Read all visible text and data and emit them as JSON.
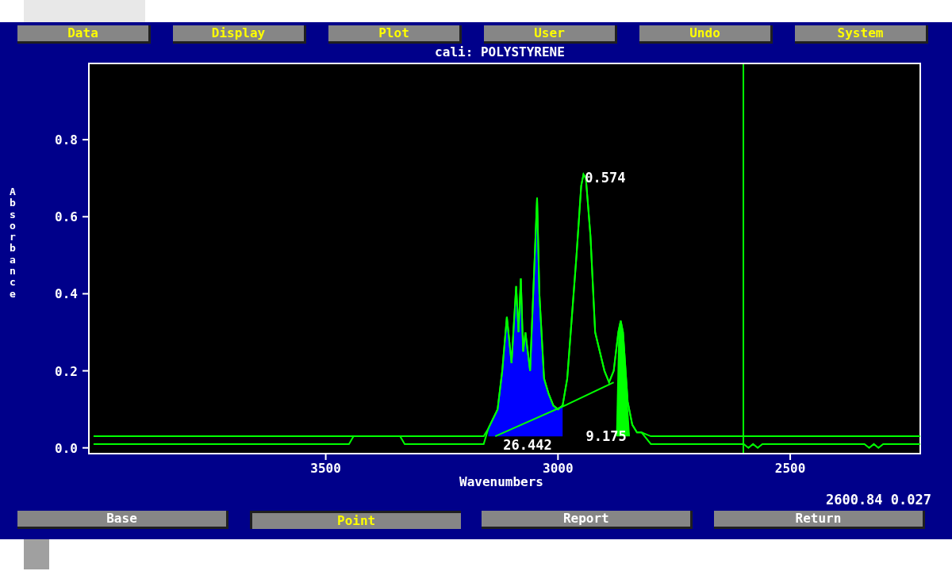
{
  "menu": [
    {
      "label": "Data"
    },
    {
      "label": "Display"
    },
    {
      "label": "Plot"
    },
    {
      "label": "User"
    },
    {
      "label": "Undo"
    },
    {
      "label": "System"
    }
  ],
  "chart": {
    "chart_data": {
      "type": "line",
      "title": "cali: POLYSTYRENE",
      "xlabel": "Wavenumbers",
      "ylabel": "Absorbance",
      "xlim": [
        4010,
        2220
      ],
      "ylim": [
        -0.015,
        1.0
      ],
      "xticks": [
        3500,
        3000,
        2500
      ],
      "yticks": [
        {
          "value": 0,
          "label": "0.0"
        },
        {
          "value": 0.2,
          "label": "0.2"
        },
        {
          "value": 0.4,
          "label": "0.4"
        },
        {
          "value": 0.6,
          "label": "0.6"
        },
        {
          "value": 0.8,
          "label": "0.8"
        }
      ],
      "x": [
        4000,
        3450,
        3440,
        3340,
        3330,
        3160,
        3150,
        3130,
        3120,
        3110,
        3100,
        3090,
        3085,
        3080,
        3075,
        3070,
        3060,
        3050,
        3045,
        3040,
        3030,
        3020,
        3010,
        3000,
        2990,
        2980,
        2960,
        2950,
        2945,
        2940,
        2930,
        2920,
        2900,
        2890,
        2880,
        2870,
        2865,
        2860,
        2850,
        2840,
        2830,
        2820,
        2800,
        2600,
        2590,
        2580,
        2570,
        2560,
        2520,
        2340,
        2330,
        2320,
        2310,
        2300,
        2220
      ],
      "series": [
        {
          "color": "#00ff00",
          "values": [
            0.03,
            0.03,
            0.03,
            0.03,
            0.03,
            0.03,
            0.05,
            0.1,
            0.2,
            0.34,
            0.22,
            0.42,
            0.3,
            0.44,
            0.25,
            0.3,
            0.2,
            0.5,
            0.65,
            0.4,
            0.18,
            0.14,
            0.11,
            0.1,
            0.11,
            0.18,
            0.5,
            0.68,
            0.71,
            0.7,
            0.55,
            0.3,
            0.2,
            0.17,
            0.2,
            0.3,
            0.33,
            0.3,
            0.12,
            0.06,
            0.04,
            0.04,
            0.03,
            0.03,
            0.03,
            0.03,
            0.03,
            0.03,
            0.03,
            0.03,
            0.03,
            0.03,
            0.03,
            0.03,
            0.03
          ]
        },
        {
          "color": "#00ff00",
          "values": [
            0.01,
            0.01,
            0.03,
            0.03,
            0.01,
            0.01,
            0.05,
            0.1,
            0.2,
            0.34,
            0.22,
            0.42,
            0.3,
            0.44,
            0.25,
            0.3,
            0.2,
            0.5,
            0.65,
            0.4,
            0.18,
            0.14,
            0.11,
            0.1,
            0.11,
            0.18,
            0.5,
            0.68,
            0.71,
            0.7,
            0.55,
            0.3,
            0.2,
            0.17,
            0.2,
            0.3,
            0.33,
            0.3,
            0.12,
            0.06,
            0.04,
            0.04,
            0.01,
            0.01,
            0.0,
            0.01,
            0.0,
            0.01,
            0.01,
            0.01,
            0.0,
            0.01,
            0.0,
            0.01,
            0.01
          ]
        }
      ],
      "ref_lines": [
        {
          "axis": "x",
          "value": 2600.84
        }
      ],
      "annotations": [
        {
          "text": "0.574"
        },
        {
          "text": "26.442"
        },
        {
          "text": "9.175"
        }
      ]
    }
  },
  "reading": "2600.84 0.027",
  "buttons": [
    {
      "label": "Base",
      "selected": false
    },
    {
      "label": "Point",
      "selected": true
    },
    {
      "label": "Report",
      "selected": false
    },
    {
      "label": "Return",
      "selected": false
    }
  ]
}
